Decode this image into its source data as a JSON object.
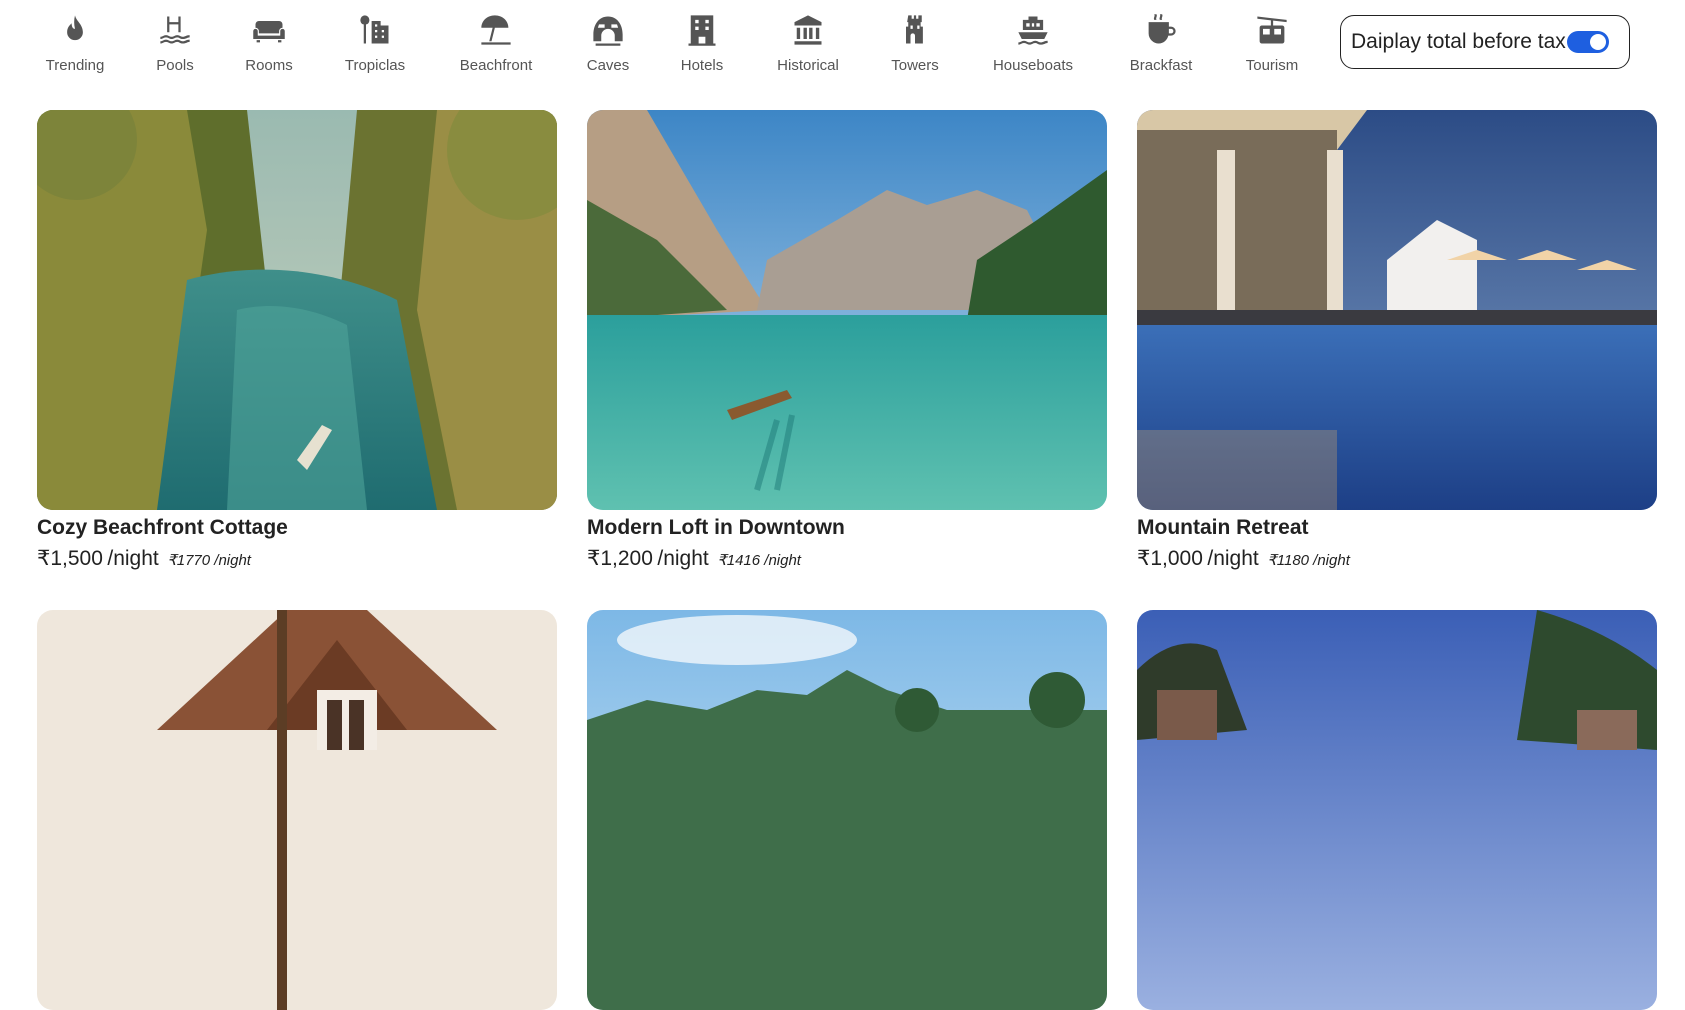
{
  "categories": [
    {
      "label": "Trending",
      "icon": "flame-icon"
    },
    {
      "label": "Pools",
      "icon": "pool-icon"
    },
    {
      "label": "Rooms",
      "icon": "sofa-icon"
    },
    {
      "label": "Tropiclas",
      "icon": "palm-building-icon"
    },
    {
      "label": "Beachfront",
      "icon": "beach-umbrella-icon"
    },
    {
      "label": "Caves",
      "icon": "cave-icon"
    },
    {
      "label": "Hotels",
      "icon": "hotel-icon"
    },
    {
      "label": "Historical",
      "icon": "museum-icon"
    },
    {
      "label": "Towers",
      "icon": "tower-icon"
    },
    {
      "label": "Houseboats",
      "icon": "houseboat-icon"
    },
    {
      "label": "Brackfast",
      "icon": "coffee-cup-icon"
    },
    {
      "label": "Tourism",
      "icon": "cable-car-icon"
    }
  ],
  "tax_toggle": {
    "label": "Daiplay total before tax",
    "enabled": true,
    "accent": "#1e5fe0"
  },
  "listings": [
    {
      "title": "Cozy Beachfront Cottage",
      "price": "₹1,500",
      "per": "/night",
      "pretax": "₹1770 /night",
      "image": "tropical-lagoon-photo"
    },
    {
      "title": "Modern Loft in Downtown",
      "price": "₹1,200",
      "per": "/night",
      "pretax": "₹1416 /night",
      "image": "mountain-lake-photo"
    },
    {
      "title": "Mountain Retreat",
      "price": "₹1,000",
      "per": "/night",
      "pretax": "₹1180 /night",
      "image": "resort-pool-photo"
    },
    {
      "title": "",
      "price": "",
      "per": "",
      "pretax": "",
      "image": "wooden-cabin-photo"
    },
    {
      "title": "",
      "price": "",
      "per": "",
      "pretax": "",
      "image": "tropical-island-photo"
    },
    {
      "title": "",
      "price": "",
      "per": "",
      "pretax": "",
      "image": "sunset-resort-photo"
    }
  ]
}
